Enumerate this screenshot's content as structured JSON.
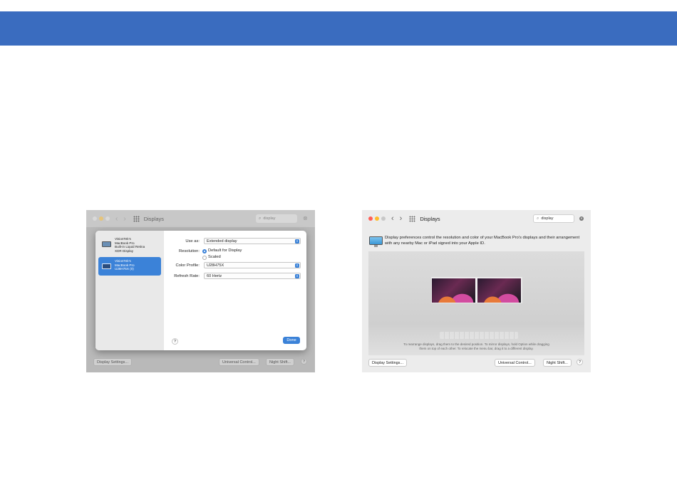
{
  "colors": {
    "band": "#3a6cbf",
    "accent": "#3b82d8",
    "close": "#ff5f57",
    "minimize": "#febc2e",
    "zoom": "#c8c8c8"
  },
  "left_window": {
    "title": "Displays",
    "search_value": "display",
    "sheet": {
      "displays": [
        {
          "lines": [
            "VisionTek's",
            "MacBook Pro",
            "Built-in Liquid Retina",
            "XDR Display"
          ]
        },
        {
          "lines": [
            "VisionTek's",
            "MacBook Pro",
            "U28H75X (0)"
          ],
          "selected": true
        }
      ],
      "use_as_label": "Use as:",
      "use_as_value": "Extended display",
      "resolution_label": "Resolution:",
      "resolution_options": [
        "Default for Display",
        "Scaled"
      ],
      "color_profile_label": "Color Profile:",
      "color_profile_value": "U28H75X",
      "refresh_label": "Refresh Rate:",
      "refresh_value": "60 Hertz",
      "help": "?",
      "done": "Done"
    },
    "footer": {
      "display_settings": "Display Settings...",
      "universal_control": "Universal Control...",
      "night_shift": "Night Shift...",
      "help": "?"
    }
  },
  "right_window": {
    "title": "Displays",
    "search_value": "display",
    "info_text": "Display preferences control the resolution and color of your MacBook Pro's displays and their arrangement with any nearby Mac or iPad signed into your Apple ID.",
    "arrange_hint_1": "To rearrange displays, drag them to the desired position. To mirror displays, hold Option while dragging",
    "arrange_hint_2": "them on top of each other. To relocate the menu bar, drag it to a different display.",
    "footer": {
      "display_settings": "Display Settings...",
      "universal_control": "Universal Control...",
      "night_shift": "Night Shift...",
      "help": "?"
    }
  }
}
